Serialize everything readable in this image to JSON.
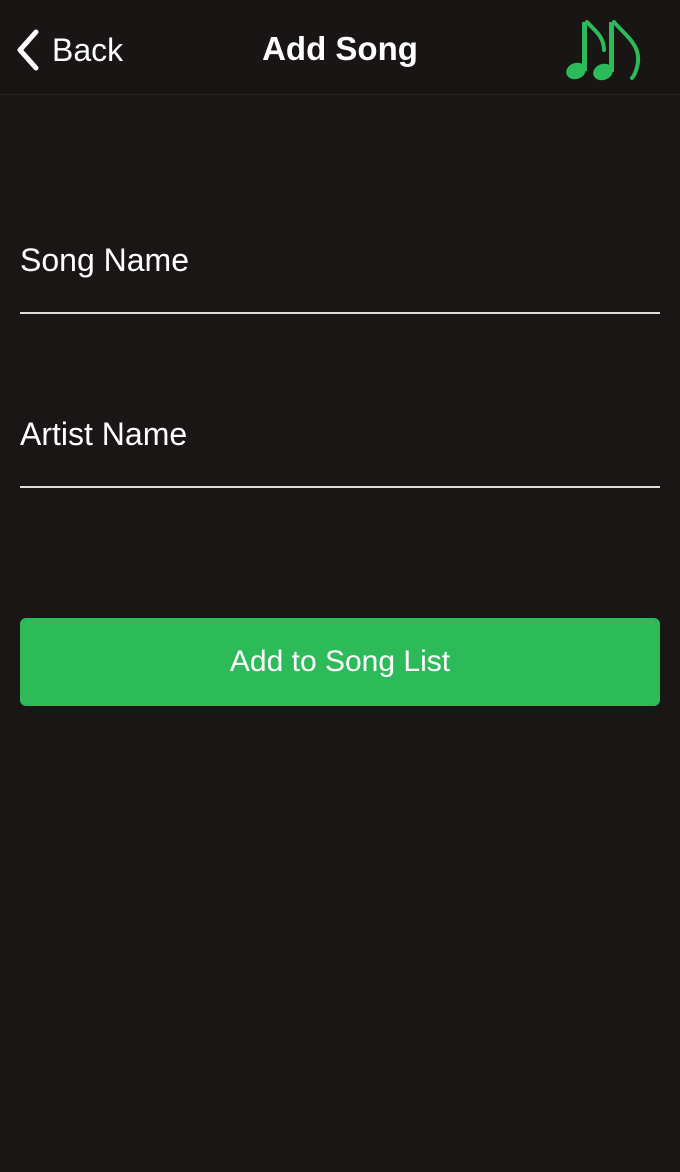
{
  "nav": {
    "back_label": "Back",
    "title": "Add Song",
    "logo_icon": "music-notes-icon"
  },
  "form": {
    "song_name": {
      "placeholder": "Song Name",
      "value": ""
    },
    "artist_name": {
      "placeholder": "Artist Name",
      "value": ""
    },
    "submit_label": "Add to Song List"
  },
  "colors": {
    "background": "#191615",
    "accent": "#2dbb5a",
    "text": "#ffffff",
    "underline": "#dcdcdc"
  }
}
